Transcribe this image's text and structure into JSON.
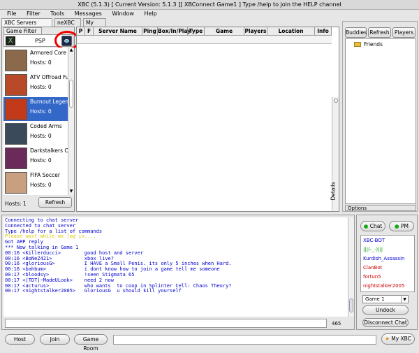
{
  "window": {
    "title": "XBC (5.1.3)     [ Current Version: 5.1.3 ][ XBConnect Game1 ] Type /help to join the HELP channel"
  },
  "menu": [
    "File",
    "Filter",
    "Tools",
    "Messages",
    "Window",
    "Help"
  ],
  "tabs": [
    "XBC Servers (classic)",
    "neXBC Lan",
    "My XBC"
  ],
  "game_filter": {
    "label": "Game Filter",
    "platform": "PSP",
    "hosts_label": "Hosts: 1",
    "refresh_label": "Refresh"
  },
  "games": [
    {
      "name": "Armored Core",
      "hosts": "Hosts: 0",
      "selected": false,
      "color": "#8a6a4a"
    },
    {
      "name": "ATV Offroad Fury",
      "hosts": "Hosts: 0",
      "selected": false,
      "color": "#b84a2a"
    },
    {
      "name": "Burnout Legends",
      "hosts": "Hosts: 0",
      "selected": true,
      "color": "#c23a1a"
    },
    {
      "name": "Coded Arms",
      "hosts": "Hosts: 0",
      "selected": false,
      "color": "#3a4a5a"
    },
    {
      "name": "Darkstalkers Chronicle",
      "hosts": "Hosts: 0",
      "selected": false,
      "color": "#6a2a5a"
    },
    {
      "name": "FIFA Soccer",
      "hosts": "Hosts: 0",
      "selected": false,
      "color": "#c8a080"
    }
  ],
  "server_table": {
    "columns": [
      "P",
      "F",
      "Server Name",
      "Ping",
      "Box/In/Play",
      "Type",
      "Game",
      "Players",
      "Location",
      "Info"
    ],
    "details_label": "Details"
  },
  "buddies": {
    "tabs": [
      "Buddies",
      "Refresh",
      "Players"
    ],
    "folder": "Friends",
    "options_label": "Options"
  },
  "chat": {
    "lines": [
      {
        "text": "Connecting to chat server",
        "color": "#0000cc"
      },
      {
        "text": "Connected to chat server",
        "color": "#0000cc"
      },
      {
        "text": "Type /help for a list of commands",
        "color": "#0000cc"
      },
      {
        "text": "Please wait while we log in....",
        "color": "#d8c800"
      },
      {
        "text": "Got ARP reply",
        "color": "#0000cc"
      },
      {
        "text": "*** Now talking in Game 1",
        "color": "#0000cc"
      },
      {
        "text": "00:16 <Killerducci>        good host and server",
        "color": "#0000cc"
      },
      {
        "text": "00:16 <BoNeZ421>           xbox live?",
        "color": "#0000cc"
      },
      {
        "text": "00:16 <gloriousG>          I HAVE a Small Penis. its only 5 inches when Hard.",
        "color": "#0000cc"
      },
      {
        "text": "00:16 <bahbum>             i dont know how to join a game tell me someone",
        "color": "#0000cc"
      },
      {
        "text": "00:17 <bloodsy>            !seen Stigmata 65",
        "color": "#0000cc"
      },
      {
        "text": "00:17 <[TDT]~MadeULook>    need 2 now",
        "color": "#0000cc"
      },
      {
        "text": "00:17 <acturus>            who wants  to coop in Splinter Cell: Chaos Theory?",
        "color": "#0000cc"
      },
      {
        "text": "00:17 <nightstalker2005>   GloriousG  u should kill yourself",
        "color": "#0000cc"
      }
    ],
    "char_count": "465",
    "chat_btn": "Chat",
    "pm_btn": "PM",
    "users": [
      {
        "name": "XBC-BOT",
        "color": "#0000cc"
      },
      {
        "name": "|||(-_-)|||",
        "color": "#009900"
      },
      {
        "name": "Kurdish_Assassin",
        "color": "#0000cc"
      },
      {
        "name": "ClanBot",
        "color": "#cc0000"
      },
      {
        "name": "fortun5",
        "color": "#cc0000"
      },
      {
        "name": "nightstalker2005",
        "color": "#cc0000"
      }
    ],
    "channel": "Game 1",
    "undock": "Undock",
    "disconnect": "Disconnect Chat"
  },
  "bottom": {
    "host": "Host",
    "join": "Join",
    "game_room": "Game Room",
    "my_xbc": "My XBC"
  }
}
